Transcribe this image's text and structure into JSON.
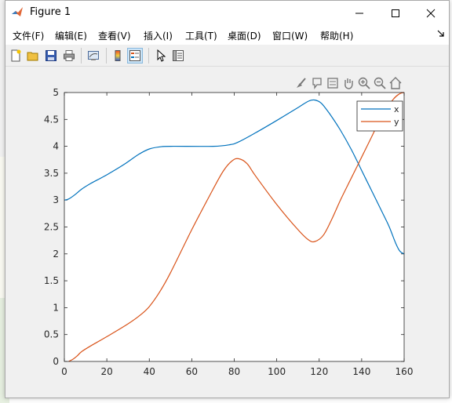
{
  "window": {
    "title": "Figure 1",
    "controls": [
      "minimize",
      "maximize",
      "close"
    ]
  },
  "menu": [
    {
      "label": "文件(F)"
    },
    {
      "label": "编辑(E)"
    },
    {
      "label": "查看(V)"
    },
    {
      "label": "插入(I)"
    },
    {
      "label": "工具(T)"
    },
    {
      "label": "桌面(D)"
    },
    {
      "label": "窗口(W)"
    },
    {
      "label": "帮助(H)"
    }
  ],
  "toolbar": {
    "buttons": [
      "new-figure-icon",
      "open-file-icon",
      "save-icon",
      "print-icon",
      "link-plot-icon",
      "colorbar-icon",
      "legend-icon",
      "edit-plot-icon",
      "property-inspector-icon"
    ],
    "pressed": "legend-icon"
  },
  "axes_toolbar": [
    "brush-icon",
    "data-tips-icon",
    "rotate-icon",
    "pan-icon",
    "zoom-in-icon",
    "zoom-out-icon",
    "home-icon"
  ],
  "chart_data": {
    "type": "line",
    "xlim": [
      0,
      160
    ],
    "ylim": [
      0,
      5
    ],
    "xticks": [
      "0",
      "20",
      "40",
      "60",
      "80",
      "100",
      "120",
      "140",
      "160"
    ],
    "yticks": [
      "0",
      "0.5",
      "1",
      "1.5",
      "2",
      "2.5",
      "3",
      "3.5",
      "4",
      "4.5",
      "5"
    ],
    "grid": false,
    "legend_position": "top-right",
    "series": [
      {
        "name": "x",
        "color": "#0072bd",
        "points": [
          [
            0,
            3
          ],
          [
            2,
            3.02
          ],
          [
            5,
            3.1
          ],
          [
            8,
            3.2
          ],
          [
            12,
            3.3
          ],
          [
            20,
            3.47
          ],
          [
            28,
            3.66
          ],
          [
            35,
            3.85
          ],
          [
            40,
            3.95
          ],
          [
            45,
            3.99
          ],
          [
            50,
            4
          ],
          [
            70,
            4
          ],
          [
            78,
            4.03
          ],
          [
            82,
            4.08
          ],
          [
            90,
            4.25
          ],
          [
            100,
            4.48
          ],
          [
            110,
            4.72
          ],
          [
            115,
            4.84
          ],
          [
            118,
            4.86
          ],
          [
            121,
            4.8
          ],
          [
            125,
            4.6
          ],
          [
            130,
            4.3
          ],
          [
            135,
            3.95
          ],
          [
            140,
            3.55
          ],
          [
            145,
            3.15
          ],
          [
            150,
            2.75
          ],
          [
            153,
            2.5
          ],
          [
            156,
            2.2
          ],
          [
            158,
            2.05
          ],
          [
            160,
            2
          ]
        ]
      },
      {
        "name": "y",
        "color": "#d95319",
        "points": [
          [
            2,
            0
          ],
          [
            4,
            0.04
          ],
          [
            6,
            0.1
          ],
          [
            8,
            0.18
          ],
          [
            12,
            0.28
          ],
          [
            20,
            0.46
          ],
          [
            30,
            0.7
          ],
          [
            36,
            0.87
          ],
          [
            40,
            1.02
          ],
          [
            45,
            1.3
          ],
          [
            50,
            1.65
          ],
          [
            60,
            2.45
          ],
          [
            70,
            3.2
          ],
          [
            75,
            3.55
          ],
          [
            79,
            3.73
          ],
          [
            82,
            3.77
          ],
          [
            86,
            3.68
          ],
          [
            90,
            3.45
          ],
          [
            100,
            2.92
          ],
          [
            110,
            2.45
          ],
          [
            115,
            2.26
          ],
          [
            118,
            2.23
          ],
          [
            122,
            2.35
          ],
          [
            126,
            2.65
          ],
          [
            130,
            3
          ],
          [
            135,
            3.4
          ],
          [
            140,
            3.8
          ],
          [
            145,
            4.2
          ],
          [
            150,
            4.6
          ],
          [
            155,
            4.88
          ],
          [
            158,
            4.98
          ],
          [
            160,
            5
          ]
        ]
      }
    ]
  }
}
